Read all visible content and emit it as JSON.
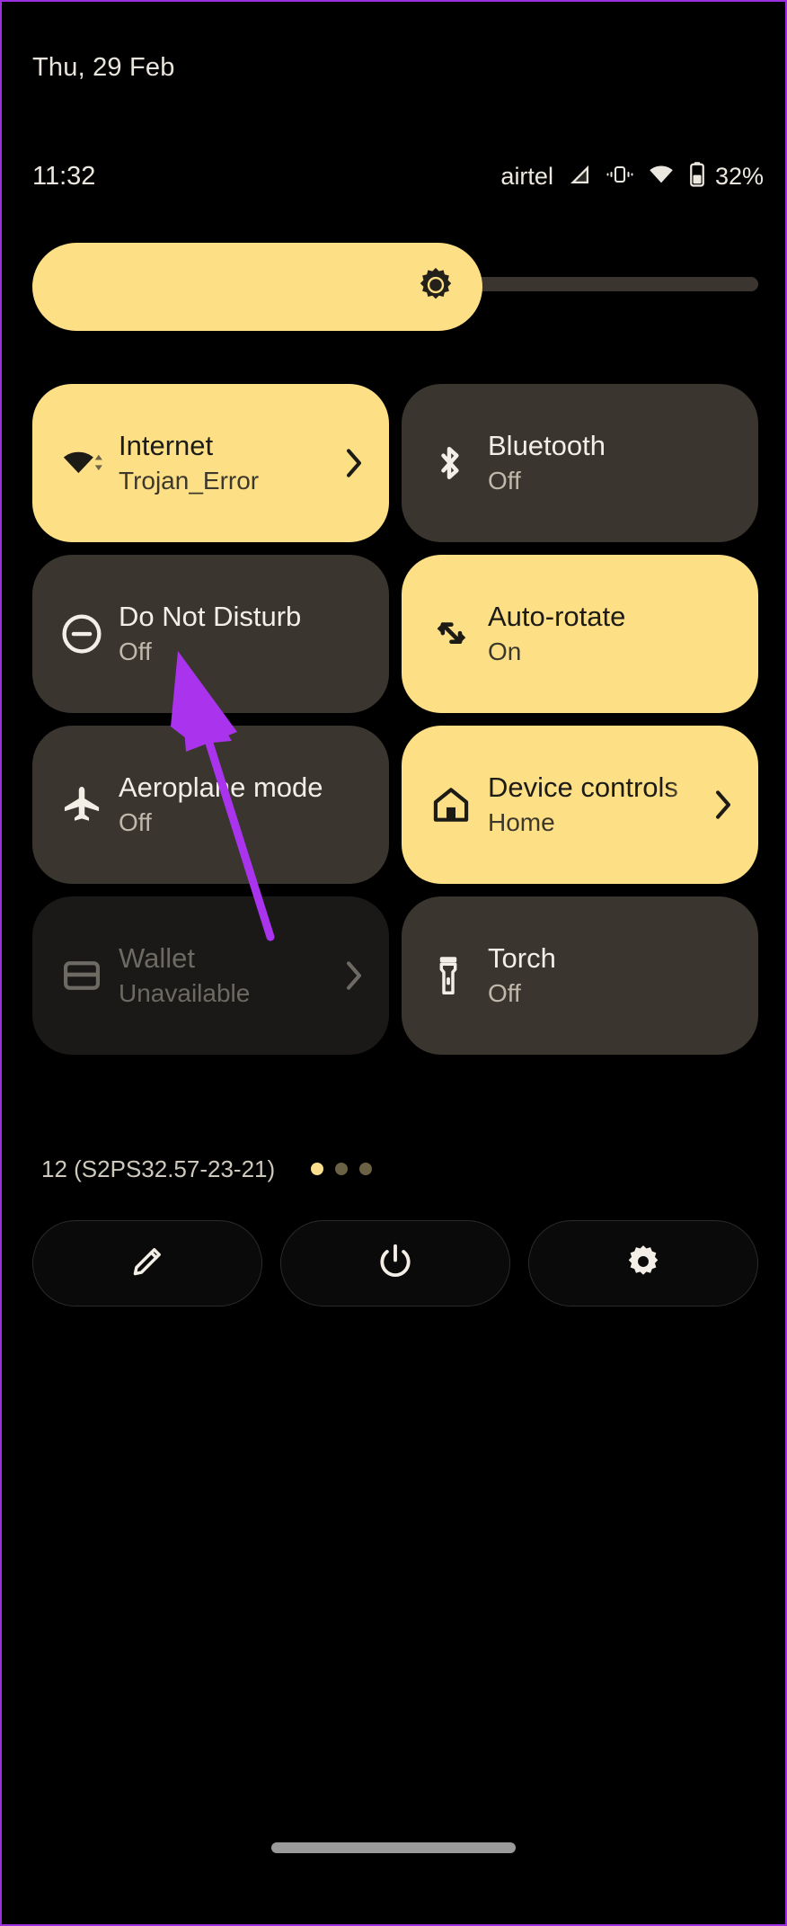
{
  "statusbar": {
    "date": "Thu, 29 Feb",
    "clock": "11:32",
    "carrier": "airtel",
    "battery_percent": "32%",
    "icons": [
      "signal-icon",
      "vibrate-icon",
      "wifi-icon",
      "battery-icon"
    ]
  },
  "brightness": {
    "name": "brightness-slider",
    "icon": "brightness-sun-icon",
    "level_percent": 62
  },
  "tiles": [
    {
      "title": "Internet",
      "subtitle": "Trojan_Error",
      "state": "on",
      "icon": "wifi-icon",
      "chevron": true,
      "name": "tile-internet"
    },
    {
      "title": "Bluetooth",
      "subtitle": "Off",
      "state": "off",
      "icon": "bluetooth-icon",
      "chevron": false,
      "name": "tile-bluetooth"
    },
    {
      "title": "Do Not Disturb",
      "subtitle": "Off",
      "state": "off",
      "icon": "do-not-disturb-icon",
      "chevron": false,
      "name": "tile-do-not-disturb"
    },
    {
      "title": "Auto-rotate",
      "subtitle": "On",
      "state": "on",
      "icon": "auto-rotate-icon",
      "chevron": false,
      "name": "tile-auto-rotate"
    },
    {
      "title": "Aeroplane mode",
      "subtitle": "Off",
      "state": "off",
      "icon": "aeroplane-icon",
      "chevron": false,
      "name": "tile-aeroplane-mode"
    },
    {
      "title": "Device controls",
      "subtitle": "Home",
      "state": "on",
      "icon": "home-icon",
      "chevron": true,
      "name": "tile-device-controls"
    },
    {
      "title": "Wallet",
      "subtitle": "Unavailable",
      "state": "disabled",
      "icon": "wallet-icon",
      "chevron": true,
      "name": "tile-wallet"
    },
    {
      "title": "Torch",
      "subtitle": "Off",
      "state": "off",
      "icon": "torch-icon",
      "chevron": false,
      "name": "tile-torch"
    }
  ],
  "footer": {
    "build_label": "12 (S2PS32.57-23-21)",
    "page_count": 3,
    "active_page": 1
  },
  "actions": [
    {
      "name": "edit-button",
      "icon": "pencil-icon"
    },
    {
      "name": "power-button",
      "icon": "power-icon"
    },
    {
      "name": "settings-button",
      "icon": "gear-icon"
    }
  ],
  "cursor": {
    "name": "pointer-arrow",
    "color": "#aa33ee"
  },
  "colors": {
    "background": "#000000",
    "tile_on": "#fddf86",
    "tile_off": "#3a362f",
    "tile_disabled": "#1a1917",
    "accent_cursor": "#aa33ee",
    "screen_border": "#9b30e0"
  },
  "nav": {
    "name": "gesture-pill"
  }
}
